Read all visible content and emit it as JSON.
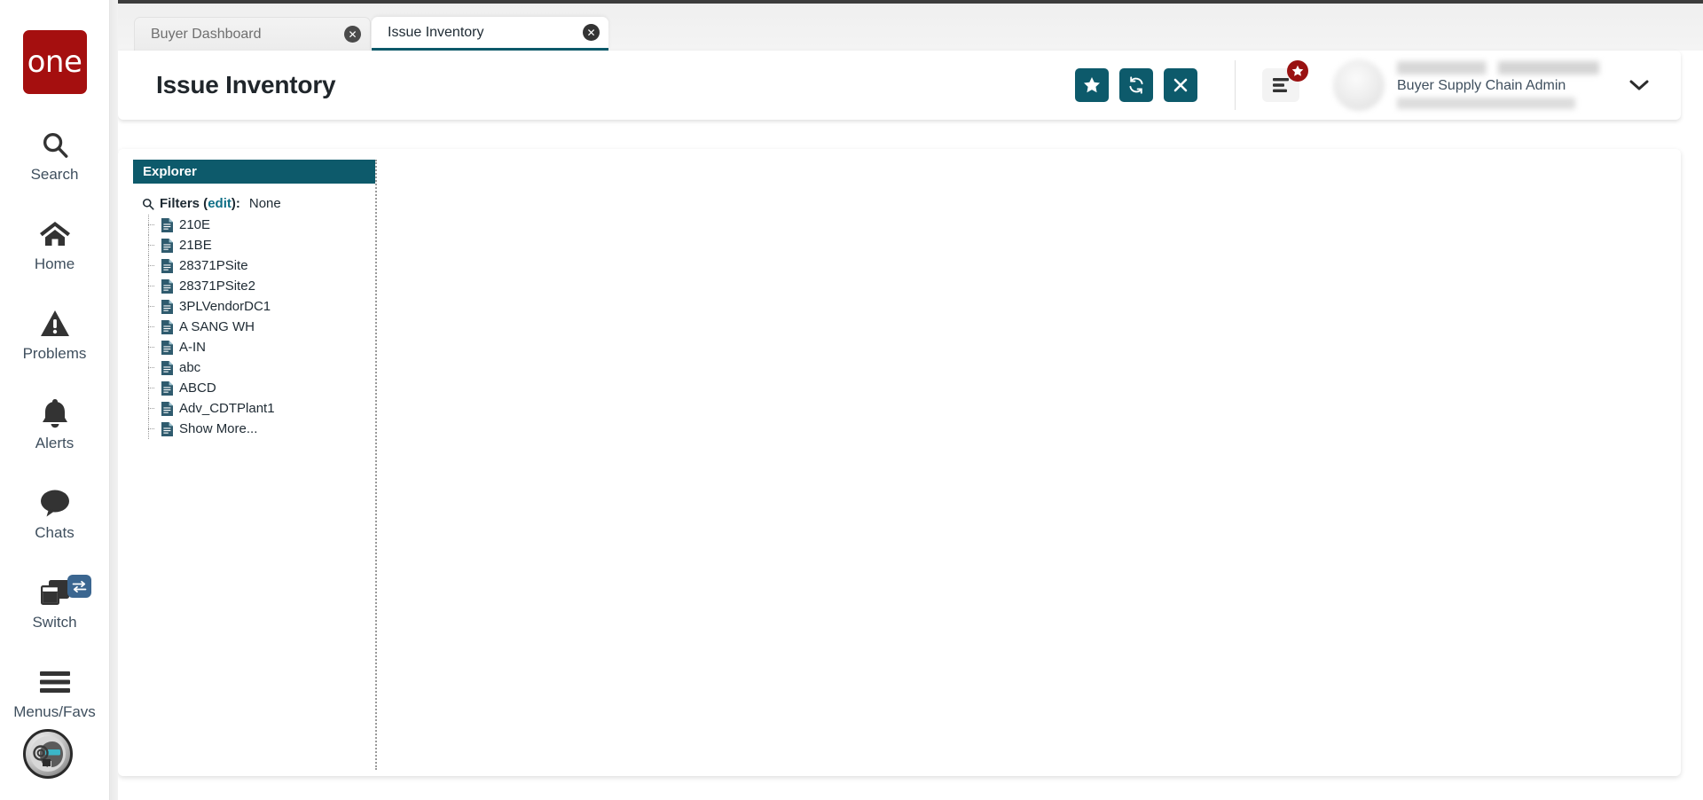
{
  "brand": {
    "logo_text": "one"
  },
  "sidebar": {
    "items": [
      {
        "label": "Search",
        "icon": "search-icon"
      },
      {
        "label": "Home",
        "icon": "home-icon"
      },
      {
        "label": "Problems",
        "icon": "warning-triangle-icon"
      },
      {
        "label": "Alerts",
        "icon": "bell-icon"
      },
      {
        "label": "Chats",
        "icon": "chat-bubble-icon"
      },
      {
        "label": "Switch",
        "icon": "switch-windows-icon",
        "badge_icon": "swap-arrows-icon"
      },
      {
        "label": "Menus/Favs",
        "icon": "hamburger-icon"
      }
    ],
    "assistant": {
      "icon": "ai-assistant-orb-icon"
    }
  },
  "tabs": [
    {
      "label": "Buyer Dashboard",
      "active": false,
      "close_icon": "close-circle-icon"
    },
    {
      "label": "Issue Inventory",
      "active": true,
      "close_icon": "close-circle-icon"
    }
  ],
  "header": {
    "title": "Issue Inventory",
    "actions": [
      {
        "name": "favorite-button",
        "icon": "star-icon"
      },
      {
        "name": "refresh-button",
        "icon": "refresh-icon"
      },
      {
        "name": "close-button",
        "icon": "x-icon"
      }
    ],
    "menus_favs": {
      "icon": "hamburger-icon",
      "badge_icon": "star-icon"
    },
    "user": {
      "name": "",
      "role": "Buyer Supply Chain Admin",
      "org": "",
      "caret_icon": "chevron-down-icon",
      "avatar_icon": "avatar"
    }
  },
  "explorer": {
    "title": "Explorer",
    "search_icon": "search-icon",
    "filters_label": "Filters (",
    "filters_edit": "edit",
    "filters_label_end": "):",
    "filters_value": "None",
    "nodes": [
      {
        "label": "210E",
        "icon": "document-icon"
      },
      {
        "label": "21BE",
        "icon": "document-icon"
      },
      {
        "label": "28371PSite",
        "icon": "document-icon"
      },
      {
        "label": "28371PSite2",
        "icon": "document-icon"
      },
      {
        "label": "3PLVendorDC1",
        "icon": "document-icon"
      },
      {
        "label": "A SANG WH",
        "icon": "document-icon"
      },
      {
        "label": "A-IN",
        "icon": "document-icon"
      },
      {
        "label": "abc",
        "icon": "document-icon"
      },
      {
        "label": "ABCD",
        "icon": "document-icon"
      },
      {
        "label": "Adv_CDTPlant1",
        "icon": "document-icon"
      },
      {
        "label": "Show More...",
        "icon": "document-icon"
      }
    ]
  },
  "colors": {
    "brand_red": "#a50f0f",
    "teal": "#0d5a6b",
    "link_teal": "#0f6f86",
    "badge_red": "#991111",
    "switch_blue": "#3b6690",
    "text_dark": "#1e2a33"
  }
}
